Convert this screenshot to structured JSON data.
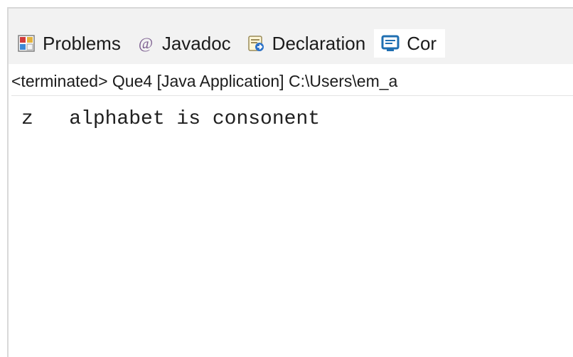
{
  "tabs": [
    {
      "label": "Problems",
      "icon": "problems-icon"
    },
    {
      "label": "Javadoc",
      "icon": "javadoc-at-icon",
      "glyph": "@"
    },
    {
      "label": "Declaration",
      "icon": "declaration-icon"
    },
    {
      "label": "Cor",
      "icon": "console-icon",
      "active": true
    }
  ],
  "status_line": "<terminated> Que4 [Java Application] C:\\Users\\em_a",
  "console_output": "z   alphabet is consonent",
  "colors": {
    "tabbar_bg": "#f2f2f2",
    "text": "#1b1b1b",
    "console_icon_blue": "#1f6fb2"
  }
}
